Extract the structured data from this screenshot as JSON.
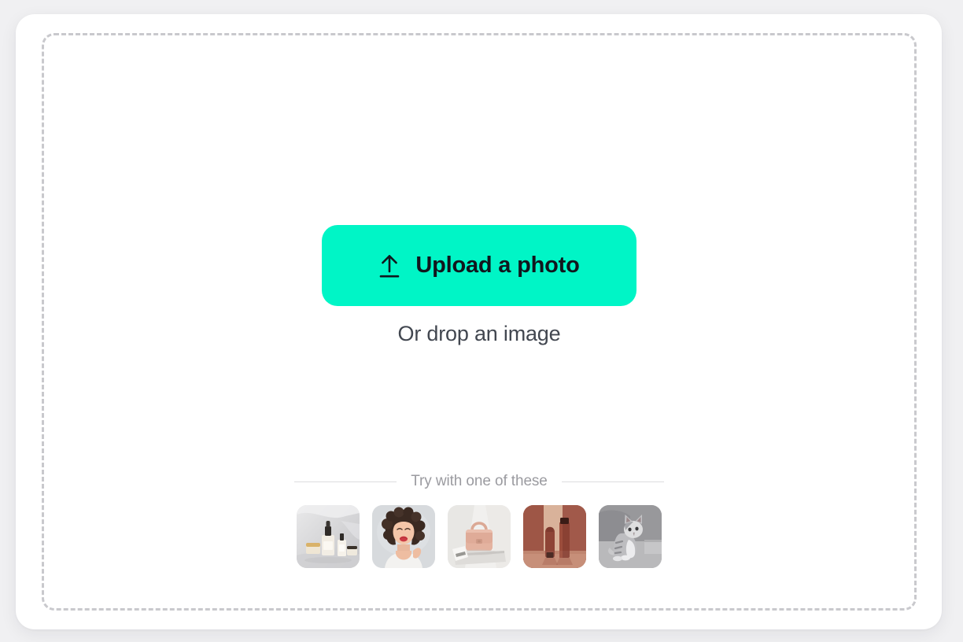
{
  "page": {
    "background_color": "#f0f0f2"
  },
  "card": {
    "background_color": "#ffffff"
  },
  "dropzone": {
    "name": "image-dropzone",
    "border_style": "dashed",
    "border_color": "#c9c9cd"
  },
  "upload_button": {
    "label": "Upload a photo",
    "icon": "upload-arrow-icon",
    "background_color": "#00f5c6",
    "text_color": "#11161d"
  },
  "drop_hint": {
    "text": "Or drop an image",
    "text_color": "#424750"
  },
  "samples": {
    "title": "Try with one of these",
    "title_color": "#9b9ba0",
    "items": [
      {
        "alt": "Skincare serum bottles on grey fabric",
        "icon": "sample-thumbnail-skincare"
      },
      {
        "alt": "Smiling woman with curly dark hair portrait",
        "icon": "sample-thumbnail-portrait"
      },
      {
        "alt": "Blush pink leather handbag",
        "icon": "sample-thumbnail-handbag"
      },
      {
        "alt": "Brown cosmetic tube and bottle on terracotta backdrop",
        "icon": "sample-thumbnail-cosmetics"
      },
      {
        "alt": "Grey and white tabby kitten sitting",
        "icon": "sample-thumbnail-kitten"
      }
    ]
  }
}
